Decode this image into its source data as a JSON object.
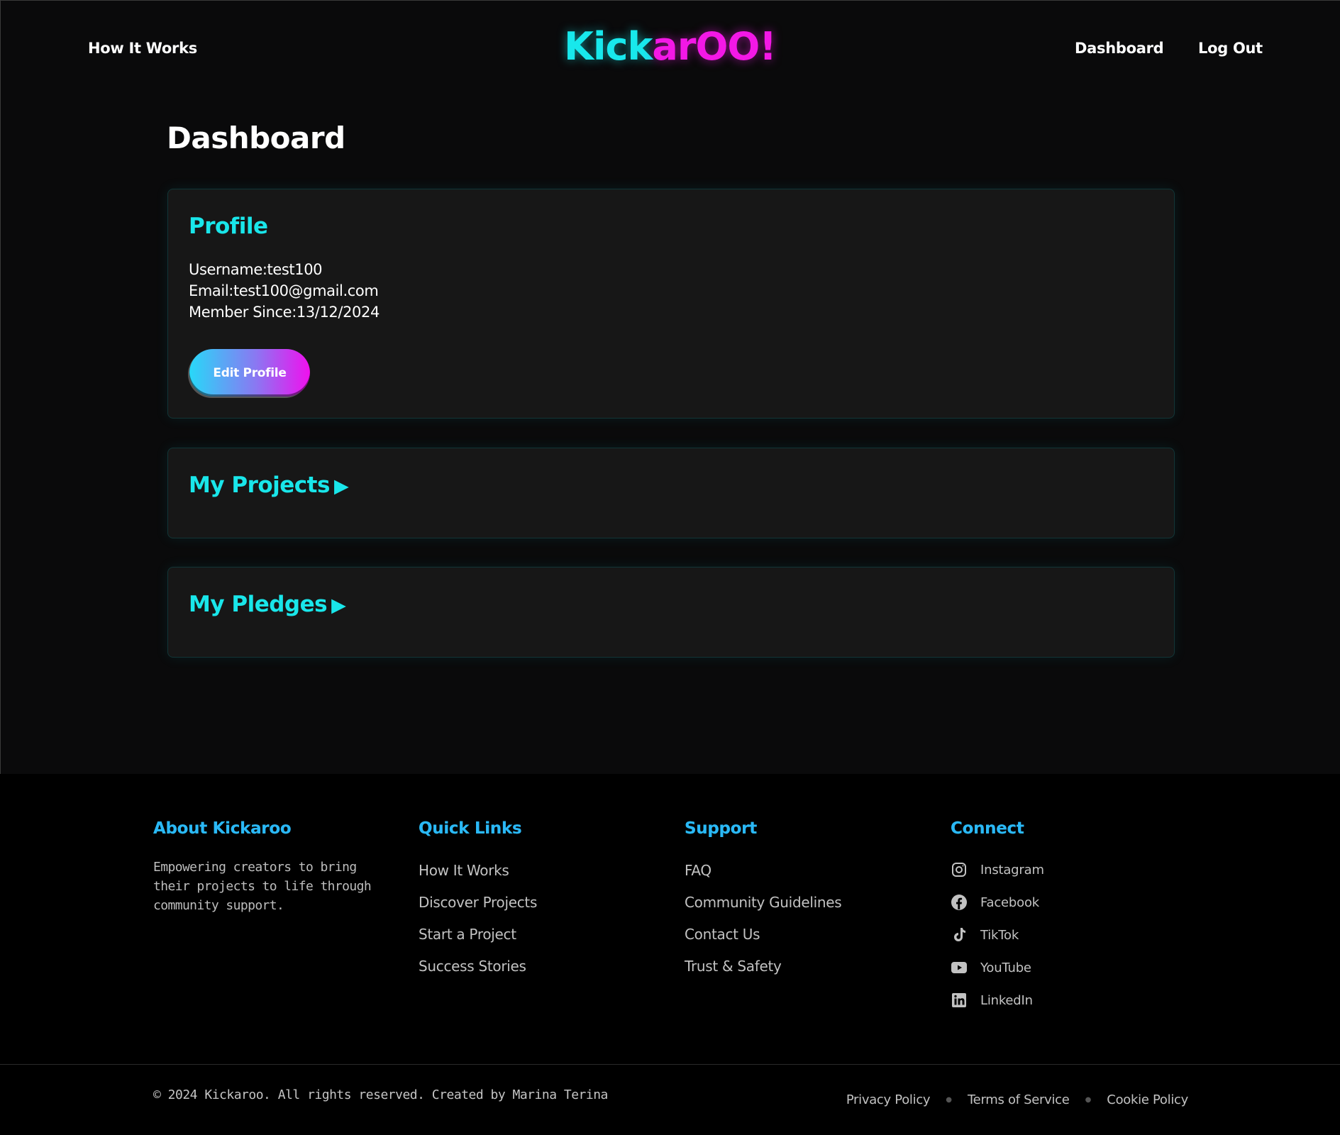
{
  "nav": {
    "how_it_works": "How It Works",
    "dashboard": "Dashboard",
    "log_out": "Log Out"
  },
  "logo": {
    "part1": "Kick",
    "part2": "arOO!"
  },
  "main": {
    "title": "Dashboard",
    "profile": {
      "heading": "Profile",
      "username": "Username:test100",
      "email": "Email:test100@gmail.com",
      "member_since": "Member Since:13/12/2024",
      "edit_button": "Edit Profile"
    },
    "projects": {
      "heading": "My Projects",
      "arrow": "▶"
    },
    "pledges": {
      "heading": "My Pledges",
      "arrow": "▶"
    }
  },
  "footer": {
    "about": {
      "heading": "About Kickaroo",
      "text": "Empowering creators to bring their projects to life through community support."
    },
    "quick_links": {
      "heading": "Quick Links",
      "items": [
        "How It Works",
        "Discover Projects",
        "Start a Project",
        "Success Stories"
      ]
    },
    "support": {
      "heading": "Support",
      "items": [
        "FAQ",
        "Community Guidelines",
        "Contact Us",
        "Trust & Safety"
      ]
    },
    "connect": {
      "heading": "Connect",
      "items": [
        {
          "label": "Instagram",
          "icon": "instagram-icon"
        },
        {
          "label": "Facebook",
          "icon": "facebook-icon"
        },
        {
          "label": "TikTok",
          "icon": "tiktok-icon"
        },
        {
          "label": "YouTube",
          "icon": "youtube-icon"
        },
        {
          "label": "LinkedIn",
          "icon": "linkedin-icon"
        }
      ]
    },
    "copyright": "© 2024 Kickaroo. All rights reserved. Created by Marina Terina",
    "legal": [
      "Privacy Policy",
      "Terms of Service",
      "Cookie Policy"
    ]
  },
  "colors": {
    "accent_cyan": "#19e6ea",
    "accent_magenta": "#f318e6",
    "background": "#0a0a0b",
    "card": "#171717",
    "footer": "#000000"
  }
}
